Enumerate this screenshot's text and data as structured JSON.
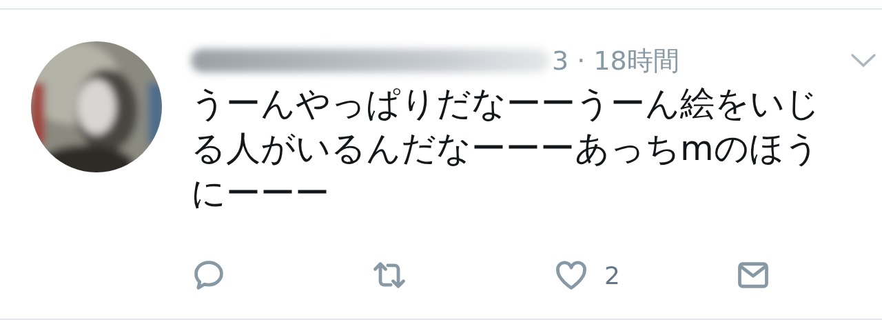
{
  "tweet": {
    "time": "3 · 18時間",
    "text": "うーんやっぱりだなーーうーん絵をいじる人がいるんだなーーーあっちmのほうにーーー",
    "actions": [
      {
        "kind": "reply"
      },
      {
        "kind": "retweet"
      },
      {
        "kind": "like",
        "count": "2"
      },
      {
        "kind": "message"
      }
    ]
  }
}
